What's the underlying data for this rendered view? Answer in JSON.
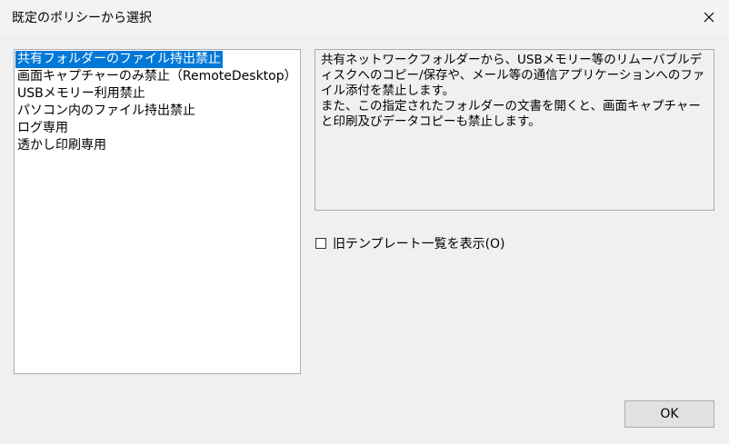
{
  "window": {
    "title": "既定のポリシーから選択"
  },
  "policy_list": {
    "items": [
      {
        "label": "共有フォルダーのファイル持出禁止",
        "selected": true
      },
      {
        "label": "画面キャプチャーのみ禁止（RemoteDesktop）",
        "selected": false
      },
      {
        "label": "USBメモリー利用禁止",
        "selected": false
      },
      {
        "label": "パソコン内のファイル持出禁止",
        "selected": false
      },
      {
        "label": "ログ専用",
        "selected": false
      },
      {
        "label": "透かし印刷専用",
        "selected": false
      }
    ]
  },
  "description": {
    "text": "共有ネットワークフォルダーから、USBメモリー等のリムーバブルディスクへのコピー/保存や、メール等の通信アプリケーションへのファイル添付を禁止します。\nまた、この指定されたフォルダーの文書を開くと、画面キャプチャーと印刷及びデータコピーも禁止します。"
  },
  "old_template_checkbox": {
    "label": "旧テンプレート一覧を表示(O)",
    "checked": false
  },
  "buttons": {
    "ok_label": "OK"
  },
  "icons": {
    "close": "close-icon"
  }
}
